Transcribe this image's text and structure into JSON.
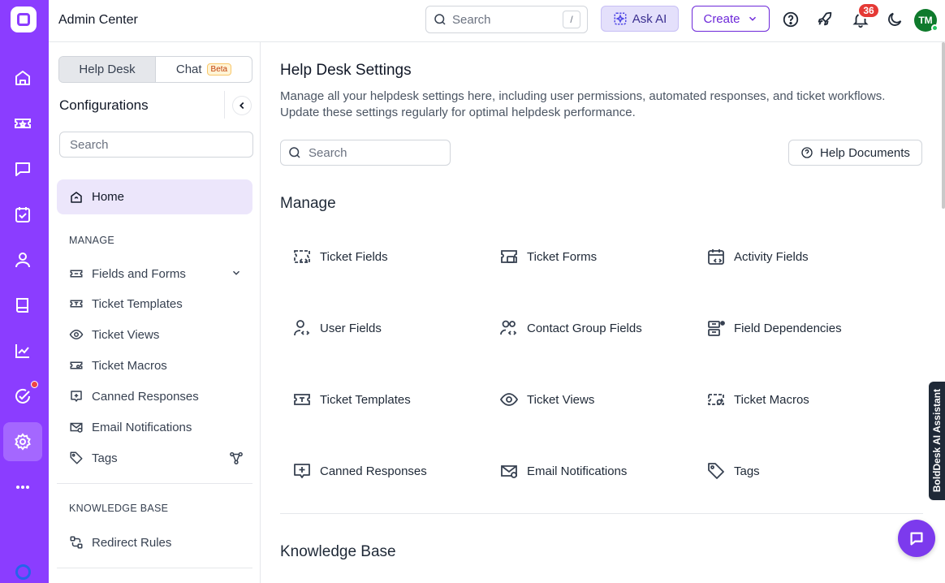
{
  "app": {
    "title": "Admin Center"
  },
  "topbar": {
    "search_placeholder": "Search",
    "search_shortcut": "/",
    "ask_ai_label": "Ask AI",
    "create_label": "Create",
    "notification_count": "36",
    "avatar_initials": "TM"
  },
  "colors": {
    "brand": "#8b3dff",
    "accent": "#6d28d9",
    "badge": "#e53935",
    "avatar": "#0f7a2c"
  },
  "rail": {
    "items": [
      "home-icon",
      "ticket-icon",
      "chat-icon",
      "task-icon",
      "contacts-icon",
      "knowledge-base-icon",
      "reports-icon",
      "activities-icon",
      "settings-icon",
      "more-icon"
    ]
  },
  "config": {
    "tabs": [
      {
        "label": "Help Desk",
        "active": true
      },
      {
        "label": "Chat",
        "badge": "Beta"
      }
    ],
    "title": "Configurations",
    "search_placeholder": "Search",
    "home_label": "Home",
    "manage_label": "MANAGE",
    "manage_items": [
      "Fields and Forms",
      "Ticket Templates",
      "Ticket Views",
      "Ticket Macros",
      "Canned Responses",
      "Email Notifications",
      "Tags"
    ],
    "kb_label": "KNOWLEDGE BASE",
    "kb_items": [
      "Redirect Rules"
    ]
  },
  "main": {
    "title": "Help Desk Settings",
    "description": "Manage all your helpdesk settings here, including user permissions, automated responses, and ticket workflows. Update these settings regularly for optimal helpdesk performance.",
    "search_placeholder": "Search",
    "help_docs_label": "Help Documents",
    "manage_heading": "Manage",
    "tiles": [
      "Ticket Fields",
      "Ticket Forms",
      "Activity Fields",
      "User Fields",
      "Contact Group Fields",
      "Field Dependencies",
      "Ticket Templates",
      "Ticket Views",
      "Ticket Macros",
      "Canned Responses",
      "Email Notifications",
      "Tags"
    ],
    "kb_heading": "Knowledge Base"
  },
  "floating": {
    "ai_assistant_label": "BoldDesk AI Assistant"
  }
}
